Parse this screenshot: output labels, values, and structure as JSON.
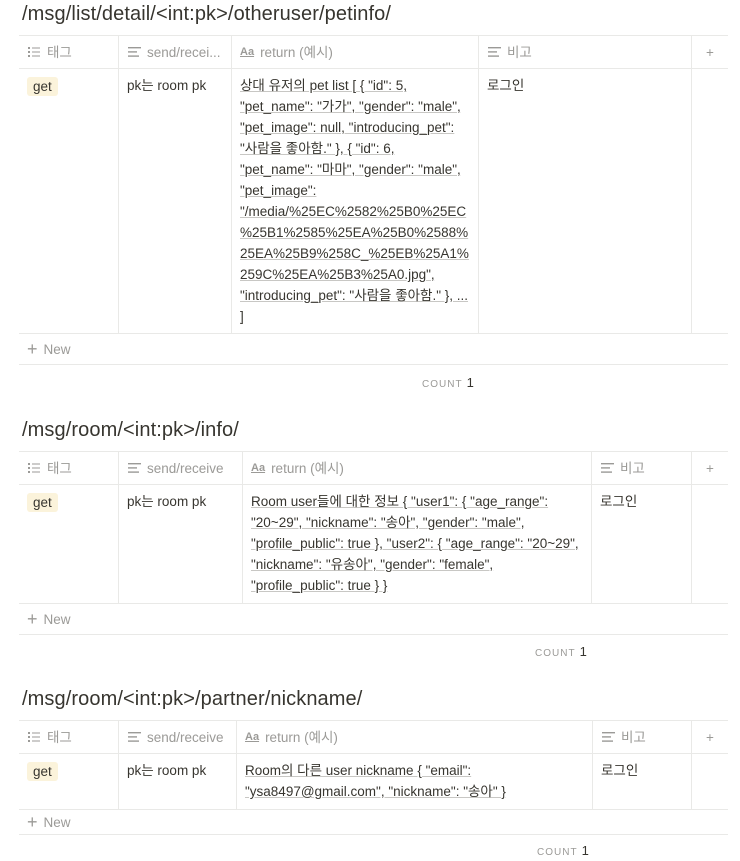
{
  "headers": {
    "tag": "태그",
    "send_full": "send/receive",
    "send_trunc": "send/recei...",
    "return": "return (예시)",
    "note": "비고",
    "add": "+"
  },
  "new_label": "New",
  "count_label": "COUNT",
  "sections": [
    {
      "title": "/msg/list/detail/<int:pk>/otheruser/petinfo/",
      "row": {
        "tag": "get",
        "send": "pk는 room pk",
        "return": "상대 유저의 pet list [ { \"id\": 5, \"pet_name\": \"가가\", \"gender\": \"male\", \"pet_image\": null, \"introducing_pet\": \"사람을 좋아함.\" }, { \"id\": 6, \"pet_name\": \"마마\", \"gender\": \"male\", \"pet_image\": \"/media/%25EC%2582%25B0%25EC%25B1%2585%25EA%25B0%2588%25EA%25B9%258C_%25EB%25A1%259C%25EA%25B3%25A0.jpg\", \"introducing_pet\": \"사람을 좋아함.\" }, ... ]",
        "note": "로그인"
      },
      "count": "1"
    },
    {
      "title": "/msg/room/<int:pk>/info/",
      "row": {
        "tag": "get",
        "send": "pk는 room pk",
        "return": "Room user들에 대한 정보 { \"user1\": { \"age_range\": \"20~29\", \"nickname\": \"송아\", \"gender\": \"male\", \"profile_public\": true }, \"user2\": { \"age_range\": \"20~29\", \"nickname\": \"유송아\", \"gender\": \"female\", \"profile_public\": true } }",
        "note": "로그인"
      },
      "count": "1"
    },
    {
      "title": "/msg/room/<int:pk>/partner/nickname/",
      "row": {
        "tag": "get",
        "send": "pk는 room pk",
        "return": "Room의 다른 user nickname { \"email\": \"ysa8497@gmail.com\", \"nickname\": \"송아\" }",
        "note": "로그인"
      },
      "count": "1"
    }
  ]
}
